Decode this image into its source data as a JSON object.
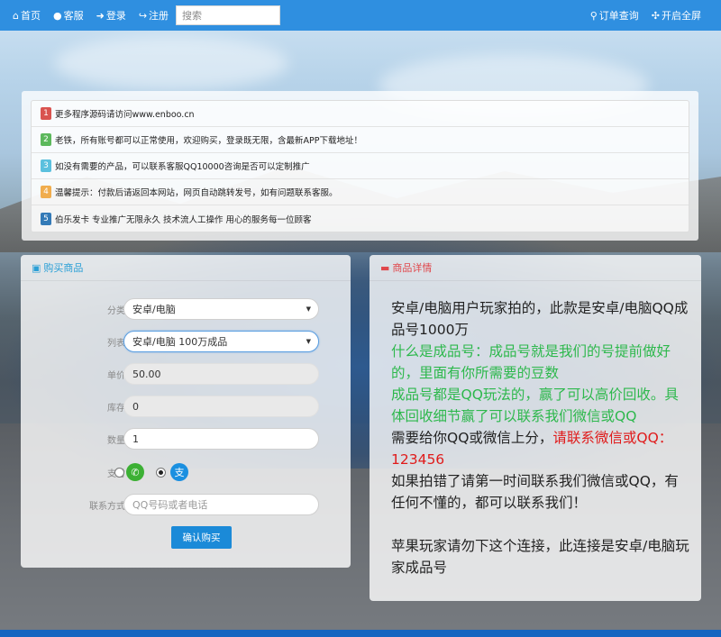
{
  "navbar": {
    "home": "首页",
    "service": "客服",
    "login": "登录",
    "register": "注册",
    "search_placeholder": "搜索",
    "order_query": "订单查询",
    "fullscreen": "开启全屏"
  },
  "notices": [
    {
      "num": "1",
      "color": "#d9534f",
      "text": "更多程序源码请访问www.enboo.cn"
    },
    {
      "num": "2",
      "color": "#5cb85c",
      "text": "老铁，所有账号都可以正常使用，欢迎购买，登录既无限，含最新APP下载地址！"
    },
    {
      "num": "3",
      "color": "#5bc0de",
      "text": "如没有需要的产品，可以联系客服QQ10000咨询是否可以定制推广"
    },
    {
      "num": "4",
      "color": "#f0ad4e",
      "text": "温馨提示：付款后请返回本网站，网页自动跳转发号，如有问题联系客服。"
    },
    {
      "num": "5",
      "color": "#337ab7",
      "text": "伯乐发卡 专业推广无限永久 技术流人工操作 用心的服务每一位顾客"
    }
  ],
  "buy": {
    "title": "购买商品",
    "category_label": "分类",
    "category_value": "安卓/电脑",
    "item_label": "列表",
    "item_value": "安卓/电脑 100万成品",
    "price_label": "单价",
    "price_value": "50.00",
    "stock_label": "库存",
    "stock_value": "0",
    "qty_label": "数量",
    "qty_value": "1",
    "pay_label": "支付",
    "pay_selected": "alipay",
    "contact_label": "联系方式",
    "contact_placeholder": "QQ号码或者电话",
    "submit": "确认购买",
    "accent": "#2a9fd6"
  },
  "detail": {
    "title": "商品详情",
    "title_color": "#e0474c",
    "line1": "安卓/电脑用户玩家拍的，此款是安卓/电脑QQ成品号1000万",
    "line2": "什么是成品号：成品号就是我们的号提前做好的，里面有你所需要的豆数",
    "line3": "成品号都是QQ玩法的，赢了可以高价回收。具体回收细节赢了可以联系我们微信或QQ",
    "line4a": "需要给你QQ或微信上分，",
    "line4b": "请联系微信或QQ：123456",
    "line5": "如果拍错了请第一时间联系我们微信或QQ，有任何不懂的，都可以联系我们！",
    "line6": "苹果玩家请勿下这个连接，此连接是安卓/电脑玩家成品号"
  }
}
